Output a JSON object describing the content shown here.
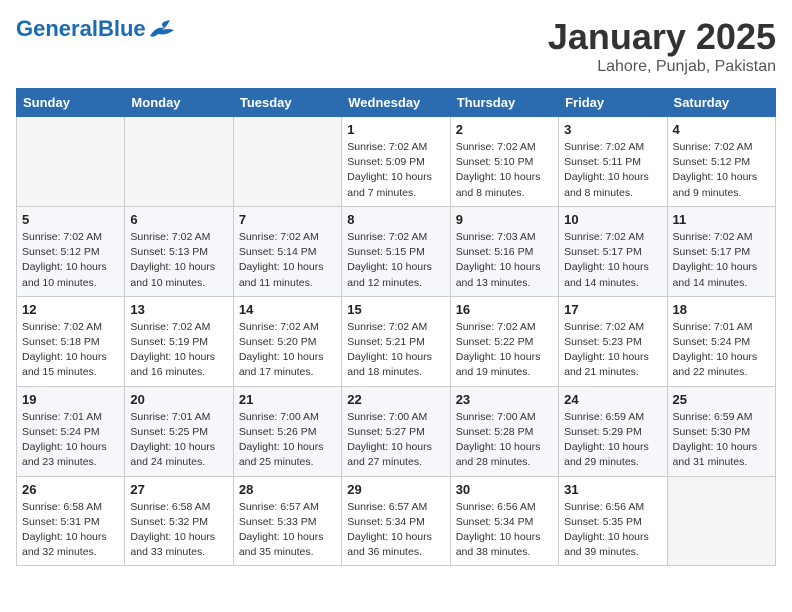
{
  "header": {
    "logo_general": "General",
    "logo_blue": "Blue",
    "calendar_title": "January 2025",
    "calendar_subtitle": "Lahore, Punjab, Pakistan"
  },
  "weekdays": [
    "Sunday",
    "Monday",
    "Tuesday",
    "Wednesday",
    "Thursday",
    "Friday",
    "Saturday"
  ],
  "weeks": [
    [
      {
        "day": "",
        "info": ""
      },
      {
        "day": "",
        "info": ""
      },
      {
        "day": "",
        "info": ""
      },
      {
        "day": "1",
        "info": "Sunrise: 7:02 AM\nSunset: 5:09 PM\nDaylight: 10 hours\nand 7 minutes."
      },
      {
        "day": "2",
        "info": "Sunrise: 7:02 AM\nSunset: 5:10 PM\nDaylight: 10 hours\nand 8 minutes."
      },
      {
        "day": "3",
        "info": "Sunrise: 7:02 AM\nSunset: 5:11 PM\nDaylight: 10 hours\nand 8 minutes."
      },
      {
        "day": "4",
        "info": "Sunrise: 7:02 AM\nSunset: 5:12 PM\nDaylight: 10 hours\nand 9 minutes."
      }
    ],
    [
      {
        "day": "5",
        "info": "Sunrise: 7:02 AM\nSunset: 5:12 PM\nDaylight: 10 hours\nand 10 minutes."
      },
      {
        "day": "6",
        "info": "Sunrise: 7:02 AM\nSunset: 5:13 PM\nDaylight: 10 hours\nand 10 minutes."
      },
      {
        "day": "7",
        "info": "Sunrise: 7:02 AM\nSunset: 5:14 PM\nDaylight: 10 hours\nand 11 minutes."
      },
      {
        "day": "8",
        "info": "Sunrise: 7:02 AM\nSunset: 5:15 PM\nDaylight: 10 hours\nand 12 minutes."
      },
      {
        "day": "9",
        "info": "Sunrise: 7:03 AM\nSunset: 5:16 PM\nDaylight: 10 hours\nand 13 minutes."
      },
      {
        "day": "10",
        "info": "Sunrise: 7:02 AM\nSunset: 5:17 PM\nDaylight: 10 hours\nand 14 minutes."
      },
      {
        "day": "11",
        "info": "Sunrise: 7:02 AM\nSunset: 5:17 PM\nDaylight: 10 hours\nand 14 minutes."
      }
    ],
    [
      {
        "day": "12",
        "info": "Sunrise: 7:02 AM\nSunset: 5:18 PM\nDaylight: 10 hours\nand 15 minutes."
      },
      {
        "day": "13",
        "info": "Sunrise: 7:02 AM\nSunset: 5:19 PM\nDaylight: 10 hours\nand 16 minutes."
      },
      {
        "day": "14",
        "info": "Sunrise: 7:02 AM\nSunset: 5:20 PM\nDaylight: 10 hours\nand 17 minutes."
      },
      {
        "day": "15",
        "info": "Sunrise: 7:02 AM\nSunset: 5:21 PM\nDaylight: 10 hours\nand 18 minutes."
      },
      {
        "day": "16",
        "info": "Sunrise: 7:02 AM\nSunset: 5:22 PM\nDaylight: 10 hours\nand 19 minutes."
      },
      {
        "day": "17",
        "info": "Sunrise: 7:02 AM\nSunset: 5:23 PM\nDaylight: 10 hours\nand 21 minutes."
      },
      {
        "day": "18",
        "info": "Sunrise: 7:01 AM\nSunset: 5:24 PM\nDaylight: 10 hours\nand 22 minutes."
      }
    ],
    [
      {
        "day": "19",
        "info": "Sunrise: 7:01 AM\nSunset: 5:24 PM\nDaylight: 10 hours\nand 23 minutes."
      },
      {
        "day": "20",
        "info": "Sunrise: 7:01 AM\nSunset: 5:25 PM\nDaylight: 10 hours\nand 24 minutes."
      },
      {
        "day": "21",
        "info": "Sunrise: 7:00 AM\nSunset: 5:26 PM\nDaylight: 10 hours\nand 25 minutes."
      },
      {
        "day": "22",
        "info": "Sunrise: 7:00 AM\nSunset: 5:27 PM\nDaylight: 10 hours\nand 27 minutes."
      },
      {
        "day": "23",
        "info": "Sunrise: 7:00 AM\nSunset: 5:28 PM\nDaylight: 10 hours\nand 28 minutes."
      },
      {
        "day": "24",
        "info": "Sunrise: 6:59 AM\nSunset: 5:29 PM\nDaylight: 10 hours\nand 29 minutes."
      },
      {
        "day": "25",
        "info": "Sunrise: 6:59 AM\nSunset: 5:30 PM\nDaylight: 10 hours\nand 31 minutes."
      }
    ],
    [
      {
        "day": "26",
        "info": "Sunrise: 6:58 AM\nSunset: 5:31 PM\nDaylight: 10 hours\nand 32 minutes."
      },
      {
        "day": "27",
        "info": "Sunrise: 6:58 AM\nSunset: 5:32 PM\nDaylight: 10 hours\nand 33 minutes."
      },
      {
        "day": "28",
        "info": "Sunrise: 6:57 AM\nSunset: 5:33 PM\nDaylight: 10 hours\nand 35 minutes."
      },
      {
        "day": "29",
        "info": "Sunrise: 6:57 AM\nSunset: 5:34 PM\nDaylight: 10 hours\nand 36 minutes."
      },
      {
        "day": "30",
        "info": "Sunrise: 6:56 AM\nSunset: 5:34 PM\nDaylight: 10 hours\nand 38 minutes."
      },
      {
        "day": "31",
        "info": "Sunrise: 6:56 AM\nSunset: 5:35 PM\nDaylight: 10 hours\nand 39 minutes."
      },
      {
        "day": "",
        "info": ""
      }
    ]
  ]
}
